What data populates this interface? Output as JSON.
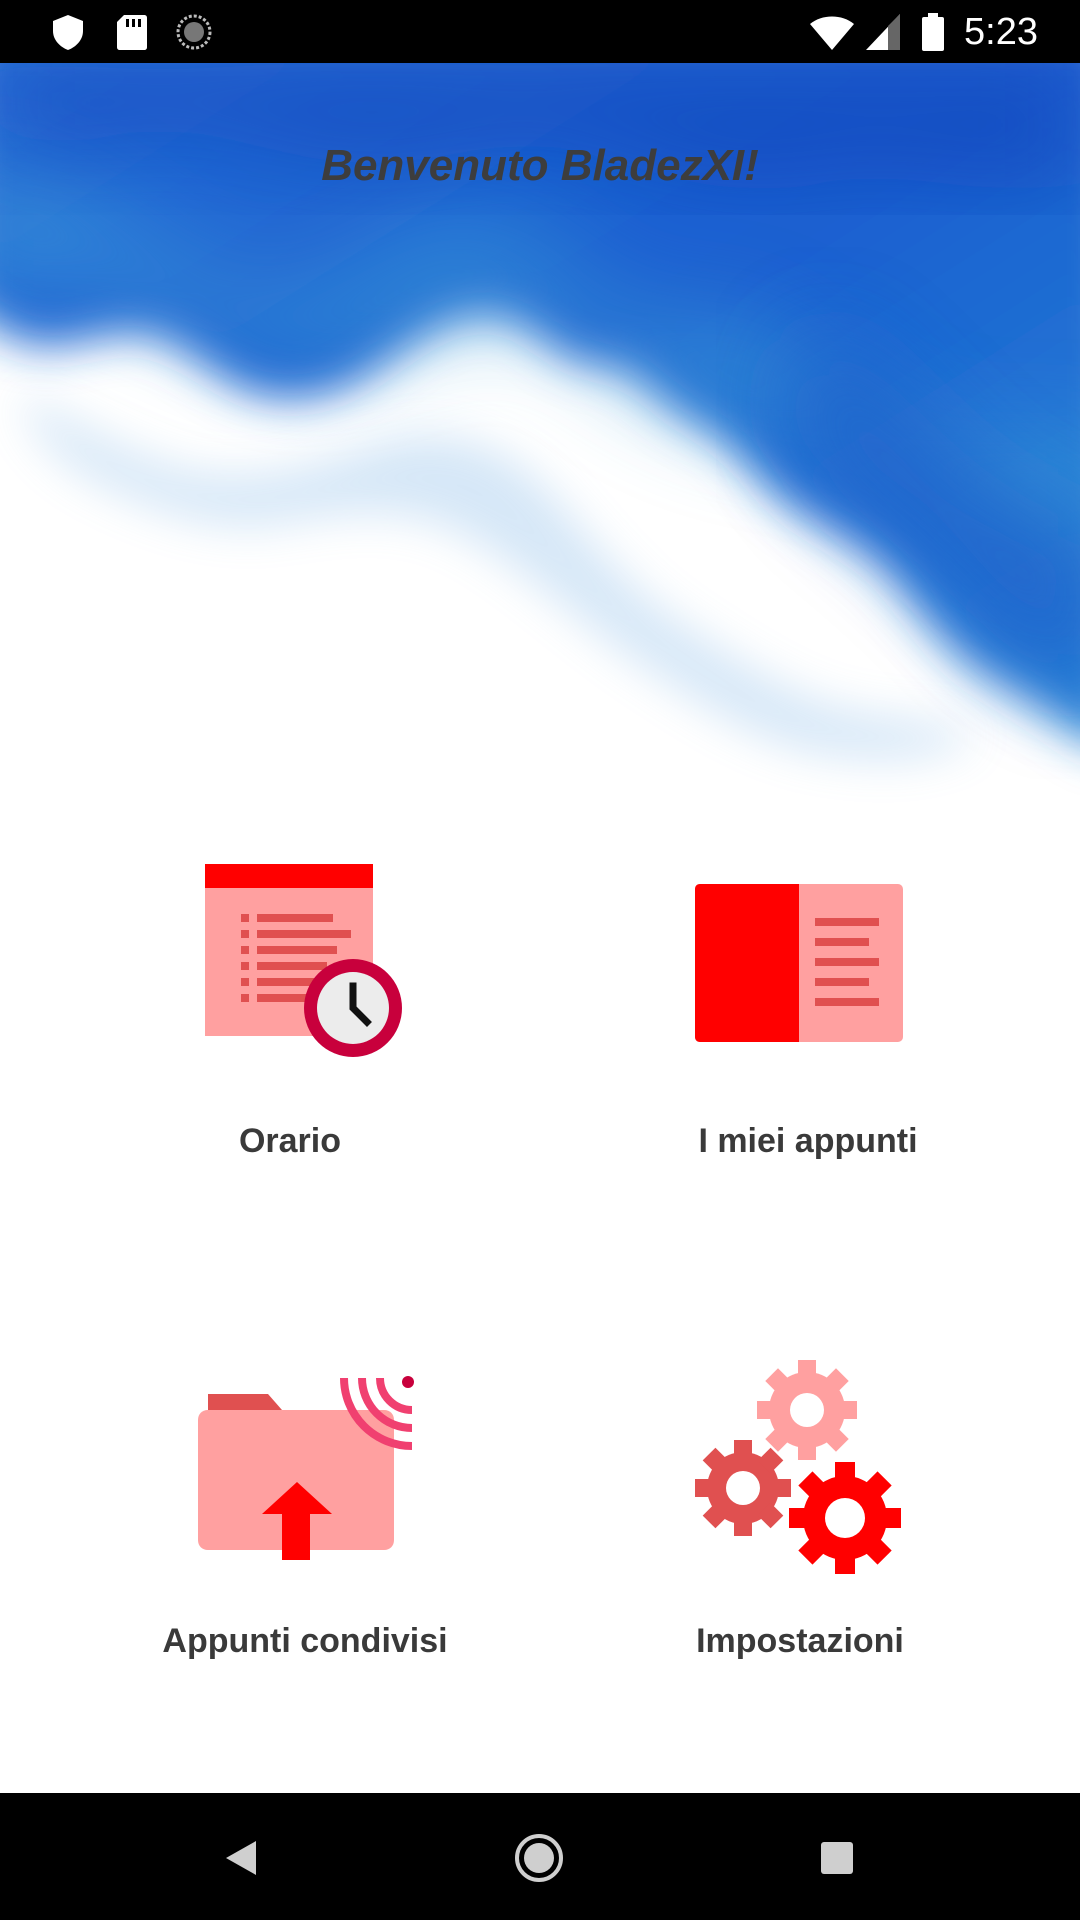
{
  "status_bar": {
    "time": "5:23",
    "icons": [
      "shield-icon",
      "sd-card-icon",
      "sync-icon",
      "wifi-icon",
      "signal-icon",
      "battery-icon"
    ]
  },
  "header": {
    "welcome_text": "Benvenuto BladezXI!"
  },
  "menu": {
    "items": [
      {
        "label": "Orario",
        "icon": "schedule-icon"
      },
      {
        "label": "I miei appunti",
        "icon": "notebook-icon"
      },
      {
        "label": "Appunti condivisi",
        "icon": "shared-folder-icon"
      },
      {
        "label": "Impostazioni",
        "icon": "gears-icon"
      }
    ]
  },
  "nav_bar": {
    "buttons": [
      "back-icon",
      "home-icon",
      "recents-icon"
    ]
  },
  "colors": {
    "accent_red": "#ff0000",
    "light_red": "#ffa0a0",
    "medium_red": "#e05050",
    "dark_red": "#c8003c",
    "background_blue": "#1a5fd0",
    "text_dark": "#3a3a3a"
  }
}
